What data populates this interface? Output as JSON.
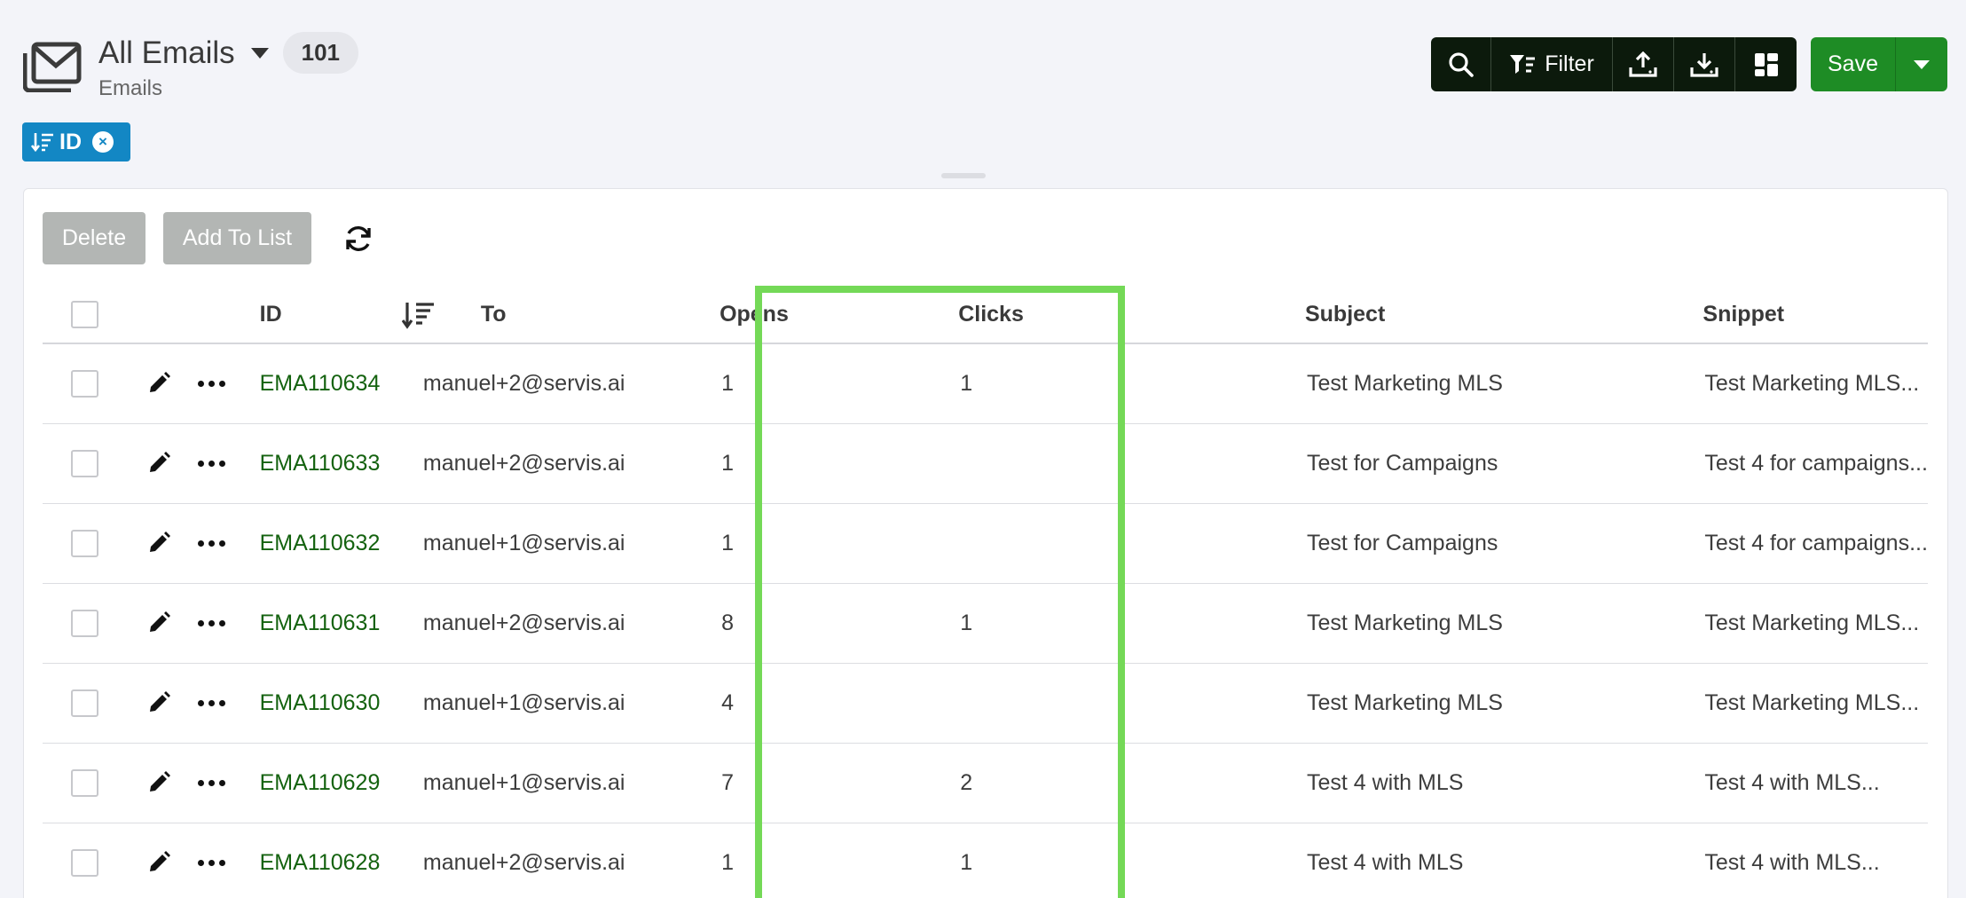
{
  "header": {
    "icon": "envelope-icon",
    "title": "All Emails",
    "count": "101",
    "subtitle": "Emails"
  },
  "sort_chip": {
    "label": "ID",
    "icon": "sort-desc-icon",
    "color": "#1387c4"
  },
  "toolbar": {
    "filter_label": "Filter",
    "save_label": "Save",
    "save_color": "#1e8c25",
    "toolbar_color": "#0c1a0c"
  },
  "actions": {
    "delete_label": "Delete",
    "add_to_list_label": "Add To List"
  },
  "table": {
    "columns": {
      "id": "ID",
      "to": "To",
      "opens": "Opens",
      "clicks": "Clicks",
      "subject": "Subject",
      "snippet": "Snippet"
    },
    "rows": [
      {
        "id": "EMA110634",
        "to": "manuel+2@servis.ai",
        "opens": "1",
        "clicks": "1",
        "subject": "Test Marketing MLS",
        "snippet": "Test Marketing MLS..."
      },
      {
        "id": "EMA110633",
        "to": "manuel+2@servis.ai",
        "opens": "1",
        "clicks": "",
        "subject": "Test for Campaigns",
        "snippet": "Test 4 for campaigns..."
      },
      {
        "id": "EMA110632",
        "to": "manuel+1@servis.ai",
        "opens": "1",
        "clicks": "",
        "subject": "Test for Campaigns",
        "snippet": "Test 4 for campaigns..."
      },
      {
        "id": "EMA110631",
        "to": "manuel+2@servis.ai",
        "opens": "8",
        "clicks": "1",
        "subject": "Test Marketing MLS",
        "snippet": "Test Marketing MLS..."
      },
      {
        "id": "EMA110630",
        "to": "manuel+1@servis.ai",
        "opens": "4",
        "clicks": "",
        "subject": "Test Marketing MLS",
        "snippet": "Test Marketing MLS..."
      },
      {
        "id": "EMA110629",
        "to": "manuel+1@servis.ai",
        "opens": "7",
        "clicks": "2",
        "subject": "Test 4 with MLS",
        "snippet": "Test 4 with MLS..."
      },
      {
        "id": "EMA110628",
        "to": "manuel+2@servis.ai",
        "opens": "1",
        "clicks": "1",
        "subject": "Test 4 with MLS",
        "snippet": "Test 4 with MLS..."
      }
    ]
  },
  "highlight_color": "#74d957"
}
